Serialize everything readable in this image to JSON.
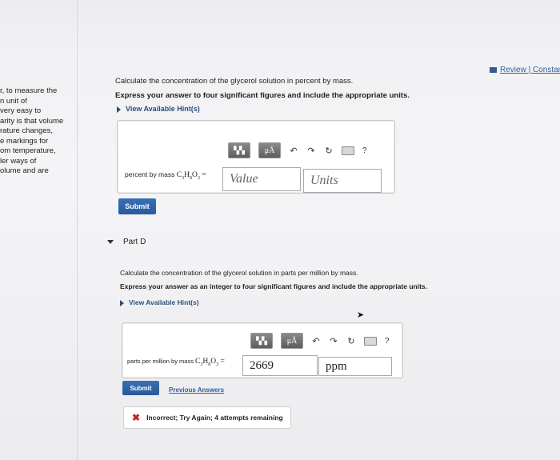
{
  "header": {
    "review_link": "Review | Constants"
  },
  "sidebar_text": [
    "r, to measure the",
    "n unit of",
    "very easy to",
    "arity is that volume",
    "rature changes,",
    "e markings for",
    "om temperature,",
    "ler ways of",
    "olume and are"
  ],
  "partC": {
    "question": "Calculate the concentration of the glycerol solution in percent by mass.",
    "instruction": "Express your answer to four significant figures and include the appropriate units.",
    "hints": "View Available Hint(s)",
    "label_prefix": "percent by mass",
    "value_placeholder": "Value",
    "units_placeholder": "Units",
    "submit": "Submit"
  },
  "toolbar": {
    "mu": "μÅ",
    "help": "?"
  },
  "partD": {
    "title": "Part D",
    "question": "Calculate the concentration of the glycerol solution in parts per million by mass.",
    "instruction": "Express your answer as an integer to four significant figures and include the appropriate units.",
    "hints": "View Available Hint(s)",
    "label_prefix": "parts per million by mass",
    "value": "2669",
    "units": "ppm",
    "submit": "Submit",
    "previous_answers": "Previous Answers",
    "feedback": "Incorrect; Try Again; 4 attempts remaining"
  },
  "icons": [
    "templates-icon",
    "symbols-icon",
    "undo-icon",
    "redo-icon",
    "reset-icon",
    "keyboard-icon",
    "help-icon"
  ],
  "colors": {
    "accent": "#285a9c",
    "error": "#c0262b"
  }
}
